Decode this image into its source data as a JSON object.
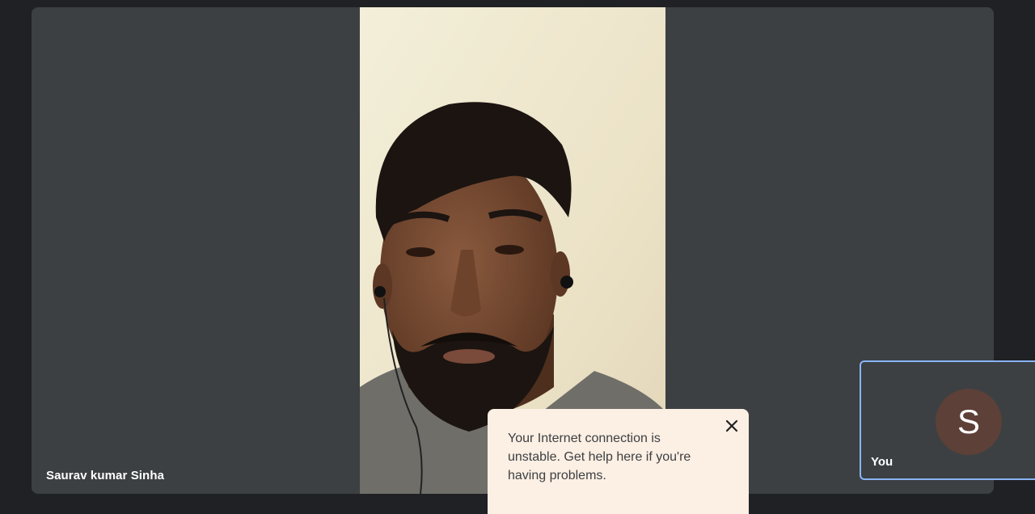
{
  "main_tile": {
    "participant_name": "Saurav kumar Sinha"
  },
  "self_tile": {
    "avatar_initial": "S",
    "label": "You"
  },
  "notification": {
    "message": "Your Internet connection is unstable. Get help here if you're having problems.",
    "close_icon": "close-icon"
  },
  "colors": {
    "background": "#202124",
    "tile": "#3c4043",
    "self_tile_border": "#8ab4f8",
    "avatar": "#5d4037",
    "notification_bg": "#fcefe3"
  }
}
